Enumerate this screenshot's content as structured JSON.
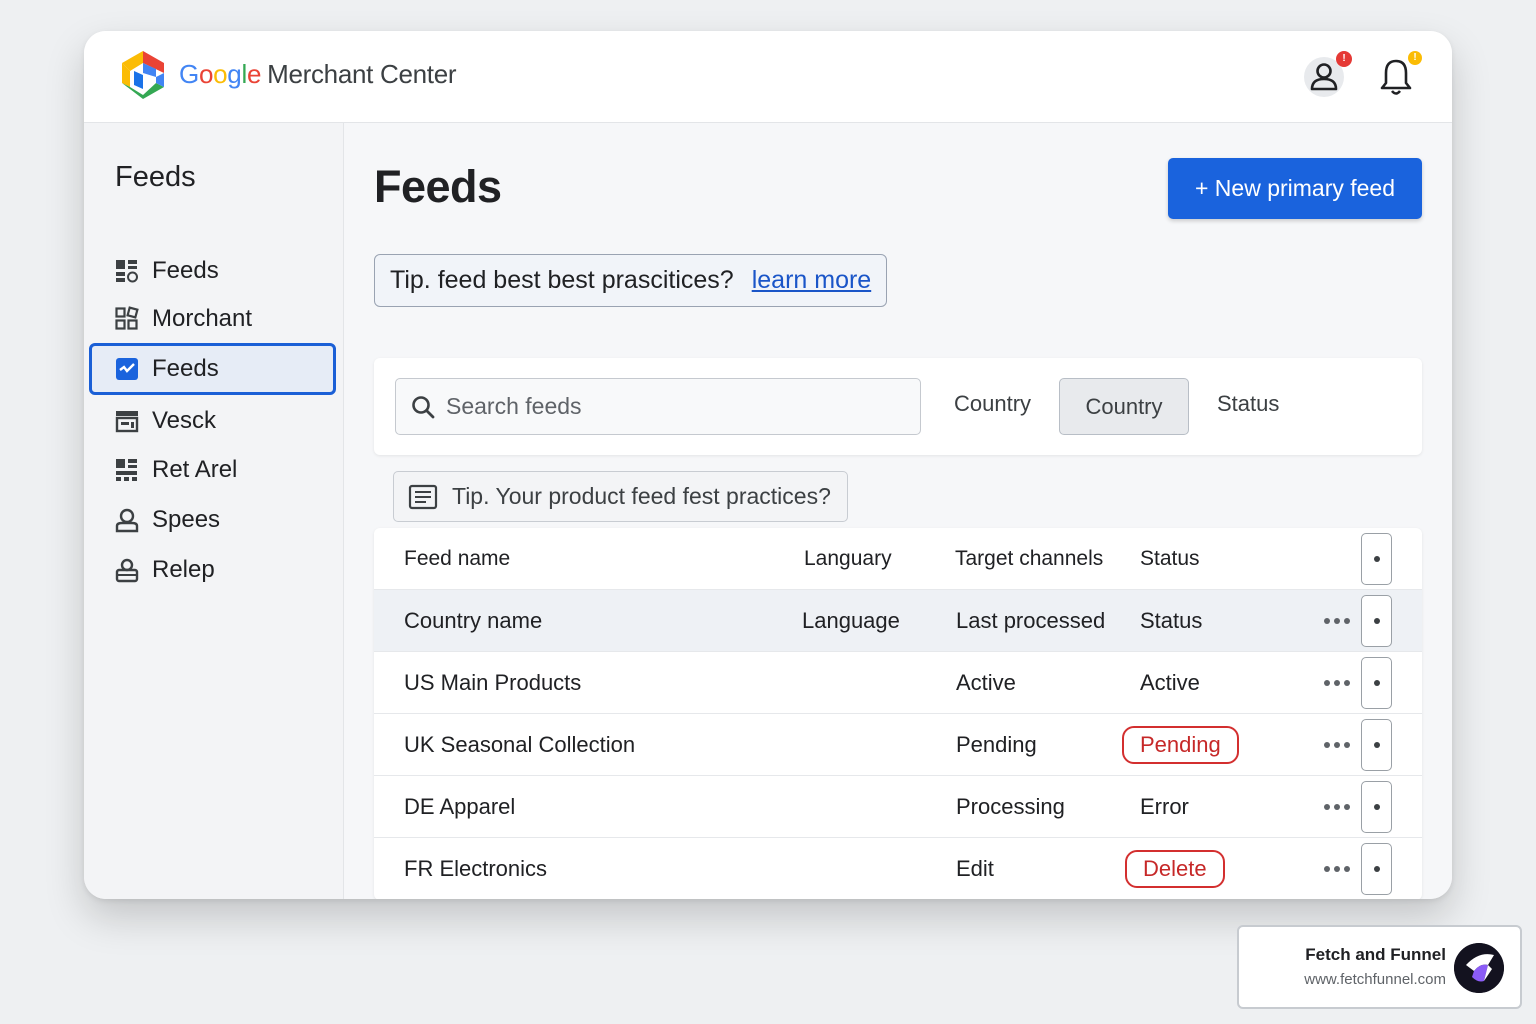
{
  "header": {
    "brand_google": "Google",
    "brand_product": "Merchant Center",
    "account_badge_color": "#e53935",
    "notification_badge_color": "#fbbc04"
  },
  "sidebar": {
    "title": "Feeds",
    "items": [
      {
        "label": "Feeds",
        "icon": "grid-icon"
      },
      {
        "label": "Morchant",
        "icon": "apps-icon"
      },
      {
        "label": "Feeds",
        "icon": "feeds-icon",
        "active": true
      },
      {
        "label": "Vesck",
        "icon": "store-icon"
      },
      {
        "label": "Ret Arel",
        "icon": "dashboard-icon"
      },
      {
        "label": "Spees",
        "icon": "user-icon"
      },
      {
        "label": "Relep",
        "icon": "lock-icon"
      }
    ]
  },
  "main": {
    "title": "Feeds",
    "new_feed_button": "+ New primary feed",
    "tip": {
      "text": "Tip. feed best best prascitices?",
      "link": "learn more"
    },
    "filters": {
      "search_placeholder": "Search feeds",
      "country_label": "Country",
      "country_chip": "Country",
      "status_label": "Status"
    },
    "tip2": "Tip. Your product feed fest practices?",
    "table": {
      "header": [
        "Feed name",
        "Languary",
        "Target channels",
        "Status"
      ],
      "subheader": [
        "Country name",
        "Language",
        "Last processed",
        "Status"
      ],
      "rows": [
        {
          "name": "US Main Products",
          "col3": "Active",
          "status": "Active",
          "pill": false
        },
        {
          "name": "UK Seasonal Collection",
          "col3": "Pending",
          "status": "Pending",
          "pill": true
        },
        {
          "name": "DE Apparel",
          "col3": "Processing",
          "status": "Error",
          "pill": false
        },
        {
          "name": "FR Electronics",
          "col3": "Edit",
          "status": "Delete",
          "pill": true
        }
      ]
    }
  },
  "watermark": {
    "name": "Fetch and Funnel",
    "url": "www.fetchfunnel.com"
  },
  "colors": {
    "accent": "#1a63dd",
    "danger": "#d32f2f",
    "google_blue": "#4285f4",
    "google_red": "#ea4335",
    "google_yellow": "#fbbc05",
    "google_green": "#34a853"
  }
}
